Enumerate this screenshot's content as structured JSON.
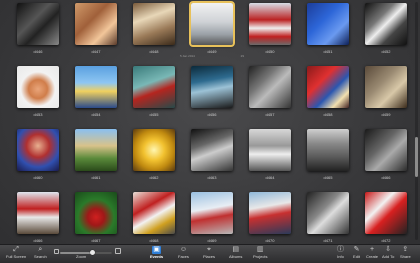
{
  "selected_info": {
    "date": "5 Jan 2014",
    "count": "29"
  },
  "rows": [
    [
      {
        "caption": "d446",
        "bg": "linear-gradient(135deg,#111 0%,#555 40%,#222 60%,#888 100%)"
      },
      {
        "caption": "d447",
        "bg": "linear-gradient(135deg,#d09a6a 0%,#a0603a 40%,#f2c69a 70%,#5a3a2a 100%)"
      },
      {
        "caption": "d448",
        "bg": "linear-gradient(160deg,#7a5a3a 0%,#e8d7b8 35%,#9a7a58 65%,#3a2a1a 100%)"
      },
      {
        "caption": "d449",
        "bg": "linear-gradient(180deg,#f2f2f2 0%,#cfd2d6 45%,#9aa0a6 75%,#555 100%)",
        "selected": true
      },
      {
        "caption": "d450",
        "bg": "linear-gradient(180deg,#d6dde6 0%,#bb2222 40%,#eee 60%,#c02020 80%,#6a6a6a 100%)"
      },
      {
        "caption": "d451",
        "bg": "linear-gradient(135deg,#1c3d9a 0%,#2d66d8 40%,#6a9af0 70%,#0c1e55 100%)"
      },
      {
        "caption": "d452",
        "bg": "linear-gradient(135deg,#111 0%,#777 35%,#eee 50%,#444 70%,#111 100%)"
      }
    ],
    [
      {
        "caption": "d453",
        "bg": "radial-gradient(circle at 50% 55%,#e9a57a 0%,#d07d4a 30%,#f2f2f2 55%,#e8e8e8 100%)"
      },
      {
        "caption": "d454",
        "bg": "linear-gradient(180deg,#5aa0e0 0%,#8ec6f2 40%,#f0d060 60%,#2a4a8a 100%)"
      },
      {
        "caption": "d455",
        "bg": "linear-gradient(160deg,#3a7a7a 0%,#79b8b6 40%,#b5251f 60%,#264a4a 100%)"
      },
      {
        "caption": "d456",
        "bg": "linear-gradient(170deg,#0c2a3a 0%,#2e6b8f 35%,#9cc2d6 55%,#1a1a1a 100%)"
      },
      {
        "caption": "d457",
        "bg": "linear-gradient(135deg,#222 0%,#777 35%,#bbb 55%,#333 100%)"
      },
      {
        "caption": "d458",
        "bg": "linear-gradient(135deg,#8a1a1a 0%,#e03030 35%,#2a56b0 60%,#f2e0b0 80%,#402020 100%)"
      },
      {
        "caption": "d459",
        "bg": "linear-gradient(135deg,#5a4a3a 0%,#9a8a72 40%,#d8c8a8 65%,#3a2a1a 100%)"
      }
    ],
    [
      {
        "caption": "d460",
        "bg": "radial-gradient(circle at 50% 40%,#e8b090 0%,#b03030 35%,#3050b0 65%,#1a1a4a 100%)"
      },
      {
        "caption": "d461",
        "bg": "linear-gradient(180deg,#8ac0f0 0%,#d8c28a 40%,#5a8a3a 70%,#2a4a1a 100%)"
      },
      {
        "caption": "d462",
        "bg": "radial-gradient(circle at 50% 50%,#fff6b0 0%,#f2c230 35%,#c08a10 65%,#5a3a10 100%)"
      },
      {
        "caption": "d463",
        "bg": "linear-gradient(160deg,#111 0%,#666 35%,#ccc 55%,#333 100%)"
      },
      {
        "caption": "d464",
        "bg": "linear-gradient(180deg,#d8d8d8 0%,#999 40%,#eee 60%,#555 100%)"
      },
      {
        "caption": "d465",
        "bg": "linear-gradient(180deg,#cfcfcf 0%,#888 35%,#555 70%,#222 100%)"
      },
      {
        "caption": "d466",
        "bg": "linear-gradient(135deg,#1a1a1a 0%,#666 40%,#aaa 60%,#2a2a2a 100%)"
      }
    ],
    [
      {
        "caption": "d466",
        "bg": "linear-gradient(180deg,#dfe6ee 0%,#c02020 40%,#e8e8e8 60%,#5a4a3a 100%)"
      },
      {
        "caption": "d467",
        "bg": "radial-gradient(circle at 50% 60%,#d02020 0%,#a01818 25%,#2a7a2a 55%,#1a4a1a 100%)"
      },
      {
        "caption": "d468",
        "bg": "linear-gradient(150deg,#e8e0d8 0%,#c02020 35%,#f2f2f2 55%,#d0a020 75%,#4a4a4a 100%)"
      },
      {
        "caption": "d469",
        "bg": "linear-gradient(170deg,#9ac0e0 0%,#e8eef4 40%,#c03030 60%,#b8b8b8 100%)"
      },
      {
        "caption": "d470",
        "bg": "linear-gradient(170deg,#8fb8d8 0%,#e8e8e8 35%,#c83030 55%,#2a3a5a 100%)"
      },
      {
        "caption": "d471",
        "bg": "linear-gradient(135deg,#222 0%,#888 40%,#ddd 55%,#333 100%)"
      },
      {
        "caption": "d472",
        "bg": "linear-gradient(135deg,#c81818 0%,#f2f2f2 35%,#d82020 55%,#222 100%)"
      }
    ]
  ],
  "toolbar": {
    "left": [
      {
        "id": "full-screen",
        "label": "Full Screen",
        "glyph": "⤢"
      },
      {
        "id": "search",
        "label": "Search",
        "glyph": "⌕"
      },
      {
        "id": "zoom",
        "label": "Zoom",
        "glyph": ""
      }
    ],
    "zoom_level": 0.62,
    "center": [
      {
        "id": "events",
        "label": "Events",
        "glyph": "▣",
        "active": true
      },
      {
        "id": "faces",
        "label": "Faces",
        "glyph": "☺"
      },
      {
        "id": "places",
        "label": "Places",
        "glyph": "⌖"
      },
      {
        "id": "albums",
        "label": "Albums",
        "glyph": "▤"
      },
      {
        "id": "projects",
        "label": "Projects",
        "glyph": "▥"
      }
    ],
    "right": [
      {
        "id": "info",
        "label": "Info",
        "glyph": "ⓘ"
      },
      {
        "id": "edit",
        "label": "Edit",
        "glyph": "✎"
      },
      {
        "id": "create",
        "label": "Create",
        "glyph": "+"
      },
      {
        "id": "add-to",
        "label": "Add To",
        "glyph": "⇩"
      },
      {
        "id": "share",
        "label": "Share",
        "glyph": "⇪"
      }
    ]
  },
  "scroll_position": 0.68,
  "colors": {
    "selection": "#e8c15a",
    "active_tab": "#2f7fd8"
  }
}
